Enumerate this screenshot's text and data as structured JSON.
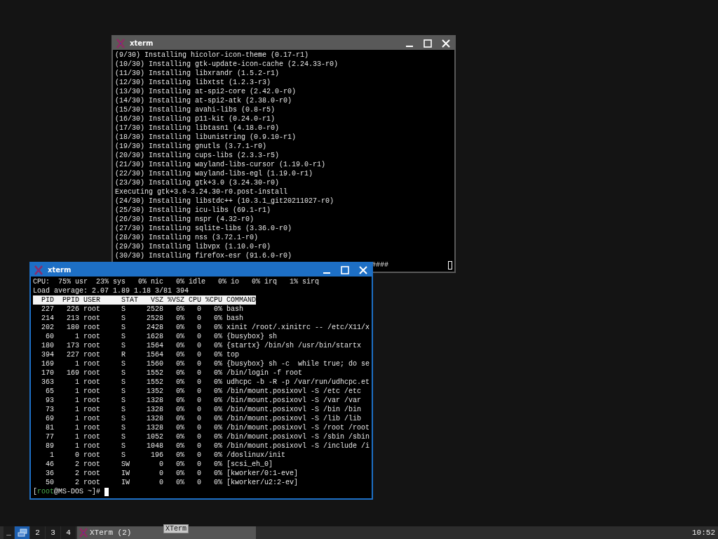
{
  "windows": [
    {
      "title": "xterm",
      "active": false,
      "lines": [
        "(9/30) Installing hicolor-icon-theme (0.17-r1)",
        "(10/30) Installing gtk-update-icon-cache (2.24.33-r0)",
        "(11/30) Installing libxrandr (1.5.2-r1)",
        "(12/30) Installing libxtst (1.2.3-r3)",
        "(13/30) Installing at-spi2-core (2.42.0-r0)",
        "(14/30) Installing at-spi2-atk (2.38.0-r0)",
        "(15/30) Installing avahi-libs (0.8-r5)",
        "(16/30) Installing p11-kit (0.24.0-r1)",
        "(17/30) Installing libtasn1 (4.18.0-r0)",
        "(18/30) Installing libunistring (0.9.10-r1)",
        "(19/30) Installing gnutls (3.7.1-r0)",
        "(20/30) Installing cups-libs (2.3.3-r5)",
        "(21/30) Installing wayland-libs-cursor (1.19.0-r1)",
        "(22/30) Installing wayland-libs-egl (1.19.0-r1)",
        "(23/30) Installing gtk+3.0 (3.24.30-r0)",
        "Executing gtk+3.0-3.24.30-r0.post-install",
        "(24/30) Installing libstdc++ (10.3.1_git20211027-r0)",
        "(25/30) Installing icu-libs (69.1-r1)",
        "(26/30) Installing nspr (4.32-r0)",
        "(27/30) Installing sqlite-libs (3.36.0-r0)",
        "(28/30) Installing nss (3.72.1-r0)",
        "(29/30) Installing libvpx (1.10.0-r0)",
        "(30/30) Installing firefox-esr (91.6.0-r0)"
      ],
      "progress_tail": "####"
    },
    {
      "title": "xterm",
      "active": true,
      "lines": [
        "CPU:  75% usr  23% sys   0% nic   0% idle   0% io   0% irq   1% sirq",
        "Load average: 2.07 1.89 1.18 3/81 394"
      ],
      "header": "  PID  PPID USER     STAT   VSZ %VSZ CPU %CPU COMMAND",
      "rows": [
        "  227   226 root     S     2528   0%   0   0% bash",
        "  214   213 root     S     2528   0%   0   0% bash",
        "  202   180 root     S     2428   0%   0   0% xinit /root/.xinitrc -- /etc/X11/x",
        "   60     1 root     S     1628   0%   0   0% {busybox} sh",
        "  180   173 root     S     1564   0%   0   0% {startx} /bin/sh /usr/bin/startx",
        "  394   227 root     R     1564   0%   0   0% top",
        "  169     1 root     S     1560   0%   0   0% {busybox} sh -c  while true; do se",
        "  170   169 root     S     1552   0%   0   0% /bin/login -f root",
        "  363     1 root     S     1552   0%   0   0% udhcpc -b -R -p /var/run/udhcpc.et",
        "   65     1 root     S     1352   0%   0   0% /bin/mount.posixovl -S /etc /etc",
        "   93     1 root     S     1328   0%   0   0% /bin/mount.posixovl -S /var /var",
        "   73     1 root     S     1328   0%   0   0% /bin/mount.posixovl -S /bin /bin",
        "   69     1 root     S     1328   0%   0   0% /bin/mount.posixovl -S /lib /lib",
        "   81     1 root     S     1328   0%   0   0% /bin/mount.posixovl -S /root /root",
        "   77     1 root     S     1052   0%   0   0% /bin/mount.posixovl -S /sbin /sbin",
        "   89     1 root     S     1048   0%   0   0% /bin/mount.posixovl -S /include /i",
        "    1     0 root     S      196   0%   0   0% /doslinux/init",
        "   46     2 root     SW       0   0%   0   0% [scsi_eh_0]",
        "   36     2 root     IW       0   0%   0   0% [kworker/0:1-eve]",
        "   50     2 root     IW       0   0%   0   0% [kworker/u2:2-ev]"
      ],
      "prompt": {
        "before": "[",
        "user": "root",
        "after": "@MS-DOS ~]# "
      }
    }
  ],
  "taskbar": {
    "show_desktop": "_",
    "workspaces": [
      {
        "selected": true
      },
      {
        "label": "2",
        "selected": false
      },
      {
        "label": "3",
        "selected": false
      },
      {
        "label": "4",
        "selected": false
      }
    ],
    "task": {
      "title": "XTerm (2)"
    },
    "tooltip": "XTerm",
    "clock": "10:52"
  }
}
